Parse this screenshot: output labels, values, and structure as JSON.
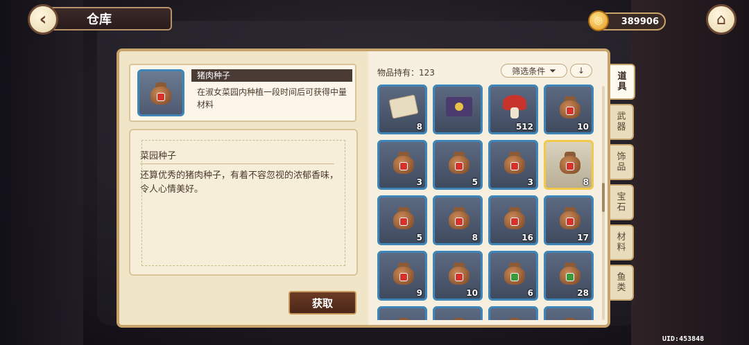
{
  "header": {
    "back_icon": "arrow-left-icon",
    "title": "仓库",
    "coins": "389906",
    "coin_icon": "gold-coin-icon",
    "home_icon": "house-icon",
    "uid": "UID:453848"
  },
  "detail": {
    "item_name": "猪肉种子",
    "item_brief": "在淑女菜园内种植一段时间后可获得中量材料",
    "category": "菜园种子",
    "description": "还算优秀的猪肉种子，有着不容忽视的浓郁香味，令人心情美好。",
    "get_button": "获取"
  },
  "inventory": {
    "holding_label": "物品持有：123",
    "filter_label": "筛选条件",
    "filter_icon": "funnel-icon",
    "sort_icon": "arrow-down-icon",
    "items": [
      {
        "icon": "map-scroll",
        "count": "8"
      },
      {
        "icon": "purple-envelope",
        "count": ""
      },
      {
        "icon": "red-mushroom",
        "count": "512"
      },
      {
        "icon": "seed-bag",
        "count": "10"
      },
      {
        "icon": "seed-bag",
        "count": "3"
      },
      {
        "icon": "seed-bag",
        "count": "5"
      },
      {
        "icon": "seed-bag",
        "count": "3"
      },
      {
        "icon": "seed-bag",
        "count": "8"
      },
      {
        "icon": "seed-bag",
        "count": "5"
      },
      {
        "icon": "seed-bag",
        "count": "8"
      },
      {
        "icon": "seed-bag",
        "count": "16"
      },
      {
        "icon": "seed-bag",
        "count": "17"
      },
      {
        "icon": "seed-bag",
        "count": "9"
      },
      {
        "icon": "seed-bag",
        "count": "10"
      },
      {
        "icon": "seed-bag-green",
        "count": "6"
      },
      {
        "icon": "seed-bag-green",
        "count": "28"
      },
      {
        "icon": "seed-bag",
        "count": ""
      },
      {
        "icon": "seed-bag",
        "count": ""
      },
      {
        "icon": "seed-bag",
        "count": ""
      },
      {
        "icon": "seed-bag",
        "count": ""
      }
    ],
    "selected_index": 7
  },
  "tabs": [
    {
      "label": "道具",
      "active": true
    },
    {
      "label": "武器",
      "active": false
    },
    {
      "label": "饰品",
      "active": false
    },
    {
      "label": "宝石",
      "active": false
    },
    {
      "label": "材料",
      "active": false
    },
    {
      "label": "鱼类",
      "active": false
    }
  ],
  "colors": {
    "panel_bg": "#f4ead4",
    "cell_border": "#3f86b8",
    "selected_border": "#f0c84a",
    "button_brown": "#5a2f1e"
  }
}
